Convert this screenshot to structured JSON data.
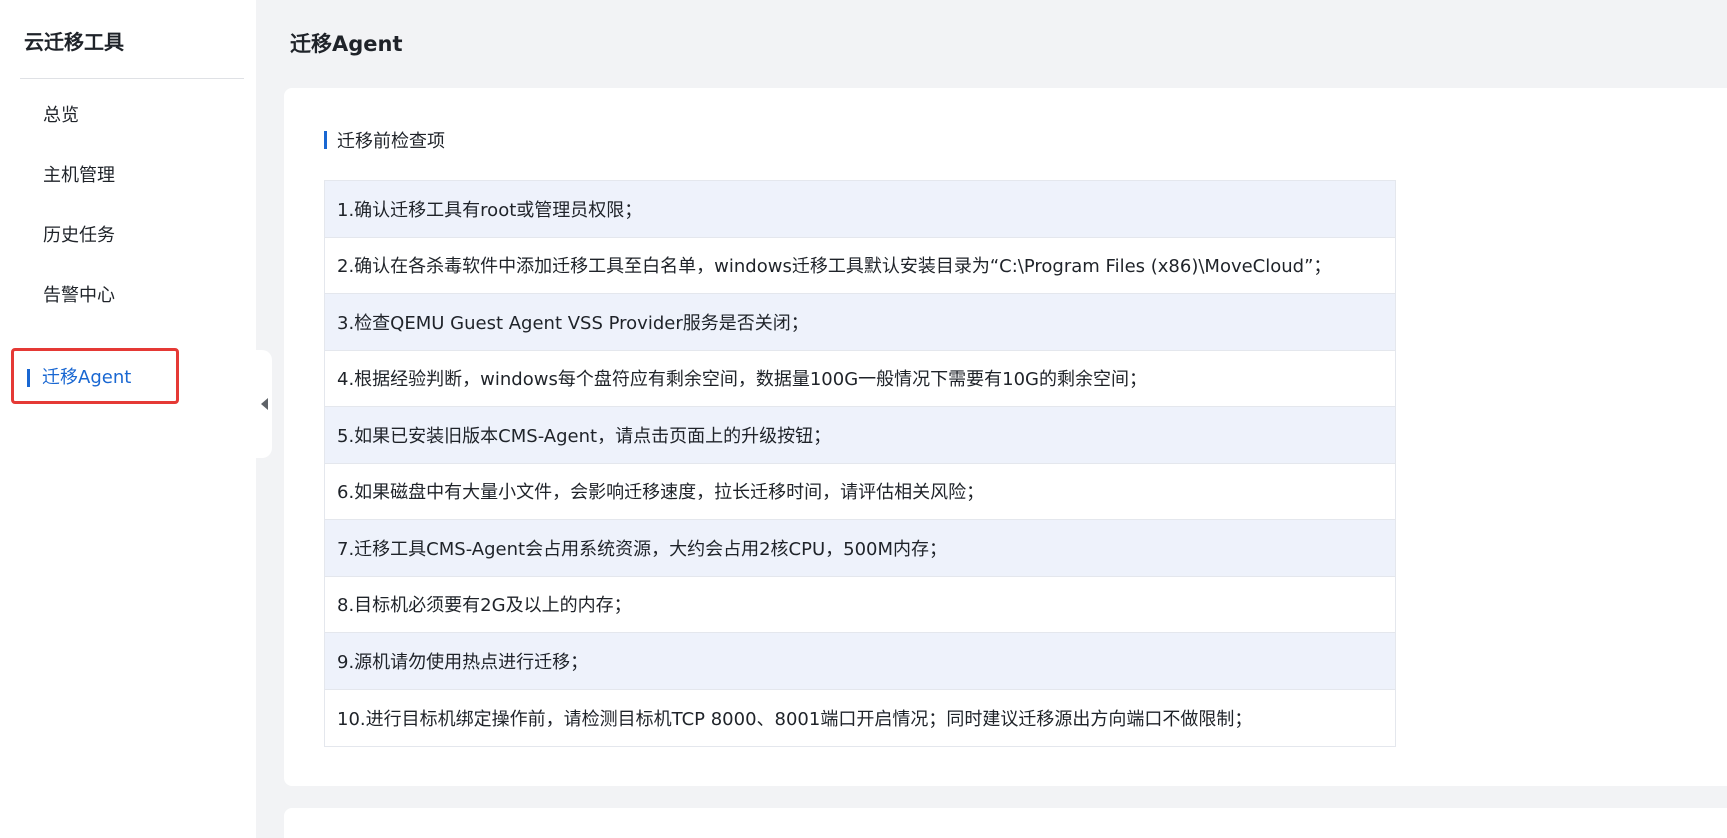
{
  "sidebar": {
    "title": "云迁移工具",
    "items": [
      {
        "label": "总览",
        "active": false
      },
      {
        "label": "主机管理",
        "active": false
      },
      {
        "label": "历史任务",
        "active": false
      },
      {
        "label": "告警中心",
        "active": false
      },
      {
        "label": "迁移Agent",
        "active": true
      }
    ]
  },
  "page": {
    "title": "迁移Agent"
  },
  "precheck": {
    "section_title": "迁移前检查项",
    "items": [
      "1.确认迁移工具有root或管理员权限；",
      "2.确认在各杀毒软件中添加迁移工具至白名单，windows迁移工具默认安装目录为“C:\\Program Files (x86)\\MoveCloud”；",
      "3.检查QEMU Guest Agent VSS Provider服务是否关闭；",
      "4.根据经验判断，windows每个盘符应有剩余空间，数据量100G一般情况下需要有10G的剩余空间；",
      "5.如果已安装旧版本CMS-Agent，请点击页面上的升级按钮；",
      "6.如果磁盘中有大量小文件，会影响迁移速度，拉长迁移时间，请评估相关风险；",
      "7.迁移工具CMS-Agent会占用系统资源，大约会占用2核CPU，500M内存；",
      "8.目标机必须要有2G及以上的内存；",
      "9.源机请勿使用热点进行迁移；",
      "10.进行目标机绑定操作前，请检测目标机TCP 8000、8001端口开启情况；同时建议迁移源出方向端口不做限制；"
    ]
  },
  "colors": {
    "accent": "#1967d2",
    "highlight_border": "#e53935",
    "row_stripe": "#eef2fb"
  },
  "icons": {
    "collapse": "caret-left-icon"
  }
}
